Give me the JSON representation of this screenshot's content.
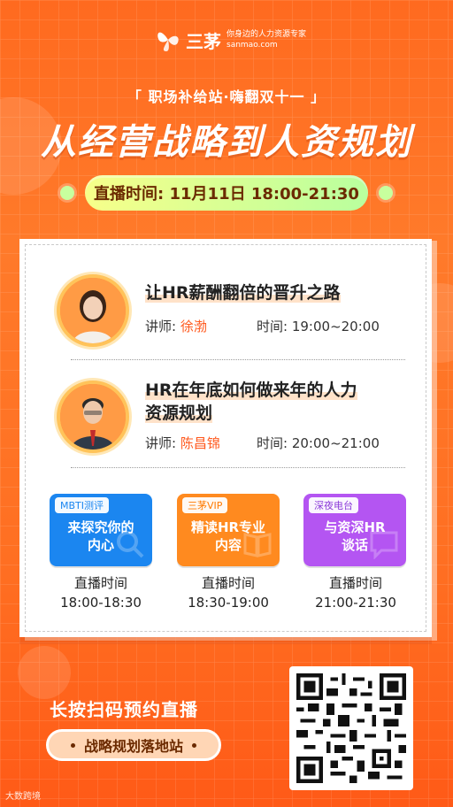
{
  "brand": {
    "name": "三茅",
    "tagline": "你身边的人力资源专家",
    "domain": "sanmao.com",
    "accent": "#ff6a1f"
  },
  "header": {
    "subtitle": "「 职场补给站·嗨翻双十一 」",
    "title": "从经营战略到人资规划",
    "live_time": "直播时间: 11月11日 18:00-21:30"
  },
  "speakers": [
    {
      "title": "让HR薪酬翻倍的晋升之路",
      "lecturer_label": "讲师:",
      "lecturer_name": "徐渤",
      "time_label": "时间:",
      "time": "19:00~20:00",
      "avatar_icon": "woman-portrait"
    },
    {
      "title_line1": "HR在年底如何做来年的人力",
      "title_line2": "资源规划",
      "lecturer_label": "讲师:",
      "lecturer_name": "陈昌锦",
      "time_label": "时间:",
      "time": "20:00~21:00",
      "avatar_icon": "man-portrait"
    }
  ],
  "cards": [
    {
      "badge": "MBTI测评",
      "line1": "来探究你的",
      "line2": "内心",
      "time_label": "直播时间",
      "time": "18:00-18:30",
      "color": "#1b86f0",
      "icon": "search-icon"
    },
    {
      "badge": "三茅VIP",
      "line1": "精读HR专业",
      "line2": "内容",
      "time_label": "直播时间",
      "time": "18:30-19:00",
      "color": "#ff8a1f",
      "icon": "book-icon"
    },
    {
      "badge": "深夜电台",
      "line1": "与资深HR",
      "line2": "谈话",
      "time_label": "直播时间",
      "time": "21:00-21:30",
      "color": "#b455f2",
      "icon": "chat-icon"
    }
  ],
  "footer": {
    "cta": "长按扫码预约直播",
    "pill": "战略规划落地站",
    "watermark": "大数跨境",
    "qr_icon": "qr-code"
  }
}
